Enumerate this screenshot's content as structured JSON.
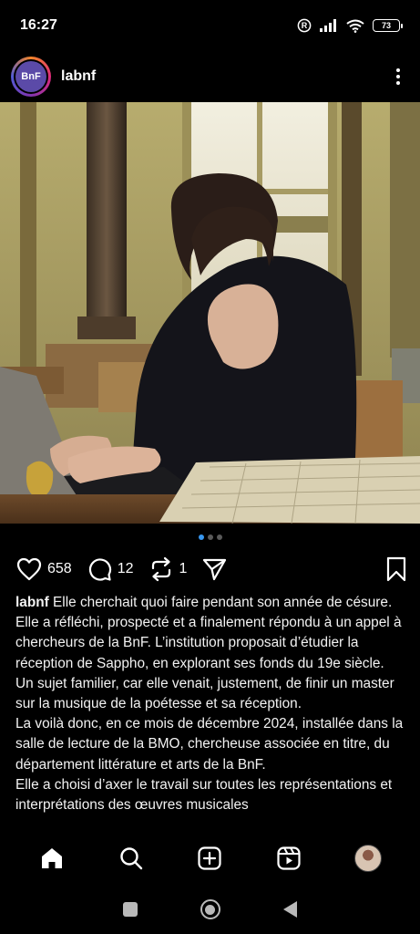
{
  "status_bar": {
    "time": "16:27",
    "battery": "73",
    "icons": [
      "registered-icon",
      "signal-icon",
      "wifi-icon",
      "battery-icon"
    ]
  },
  "post": {
    "username": "labnf",
    "avatar_text": "BnF",
    "likes": "658",
    "comments": "12",
    "reposts": "1",
    "carousel": {
      "count": 3,
      "active_index": 0
    },
    "photo_description_icon": "photo-icon"
  },
  "caption": {
    "username": "labnf",
    "paragraphs": [
      "Elle cherchait quoi faire pendant son année de césure. Elle a réfléchi, prospecté et  a finalement répondu à un appel à chercheurs de la BnF. L’institution proposait d’étudier la réception de Sappho, en explorant ses fonds du 19e siècle.",
      "Un sujet familier, car elle venait, justement, de finir un master sur la musique de la poétesse et sa réception.",
      "La voilà donc, en ce mois de décembre 2024, installée dans la salle de lecture de la BMO, chercheuse associée en titre, du département littérature et arts de la BnF.",
      "Elle a choisi d’axer le travail sur toutes les représentations et interprétations des œuvres musicales"
    ]
  },
  "bottom_nav": {
    "items": [
      "home-icon",
      "search-icon",
      "create-icon",
      "reels-icon",
      "profile-avatar"
    ]
  },
  "colors": {
    "background": "#000000",
    "text": "#f5f5f5",
    "carousel_active": "#3897f0"
  }
}
